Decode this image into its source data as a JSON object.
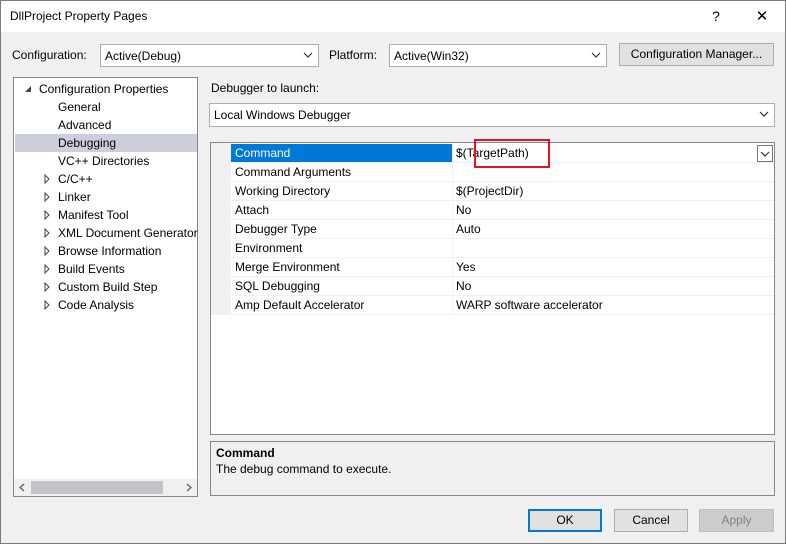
{
  "window": {
    "title": "DllProject Property Pages",
    "help_label": "?",
    "close_label": "✕"
  },
  "configuration": {
    "label": "Configuration:",
    "value": "Active(Debug)"
  },
  "platform": {
    "label": "Platform:",
    "value": "Active(Win32)"
  },
  "config_manager_label": "Configuration Manager...",
  "tree": {
    "root": "Configuration Properties",
    "children": [
      {
        "label": "General",
        "expandable": false
      },
      {
        "label": "Advanced",
        "expandable": false
      },
      {
        "label": "Debugging",
        "expandable": false,
        "selected": true
      },
      {
        "label": "VC++ Directories",
        "expandable": false
      },
      {
        "label": "C/C++",
        "expandable": true
      },
      {
        "label": "Linker",
        "expandable": true
      },
      {
        "label": "Manifest Tool",
        "expandable": true
      },
      {
        "label": "XML Document Generator",
        "expandable": true
      },
      {
        "label": "Browse Information",
        "expandable": true
      },
      {
        "label": "Build Events",
        "expandable": true
      },
      {
        "label": "Custom Build Step",
        "expandable": true
      },
      {
        "label": "Code Analysis",
        "expandable": true
      }
    ]
  },
  "debugger": {
    "label": "Debugger to launch:",
    "value": "Local Windows Debugger"
  },
  "properties": [
    {
      "name": "Command",
      "value": "$(TargetPath)"
    },
    {
      "name": "Command Arguments",
      "value": ""
    },
    {
      "name": "Working Directory",
      "value": "$(ProjectDir)"
    },
    {
      "name": "Attach",
      "value": "No"
    },
    {
      "name": "Debugger Type",
      "value": "Auto"
    },
    {
      "name": "Environment",
      "value": ""
    },
    {
      "name": "Merge Environment",
      "value": "Yes"
    },
    {
      "name": "SQL Debugging",
      "value": "No"
    },
    {
      "name": "Amp Default Accelerator",
      "value": "WARP software accelerator"
    }
  ],
  "description": {
    "title": "Command",
    "text": "The debug command to execute."
  },
  "buttons": {
    "ok": "OK",
    "cancel": "Cancel",
    "apply": "Apply"
  },
  "colors": {
    "selection": "#0078d7",
    "highlight_box": "#e81123",
    "tree_selection": "#cccedb"
  }
}
